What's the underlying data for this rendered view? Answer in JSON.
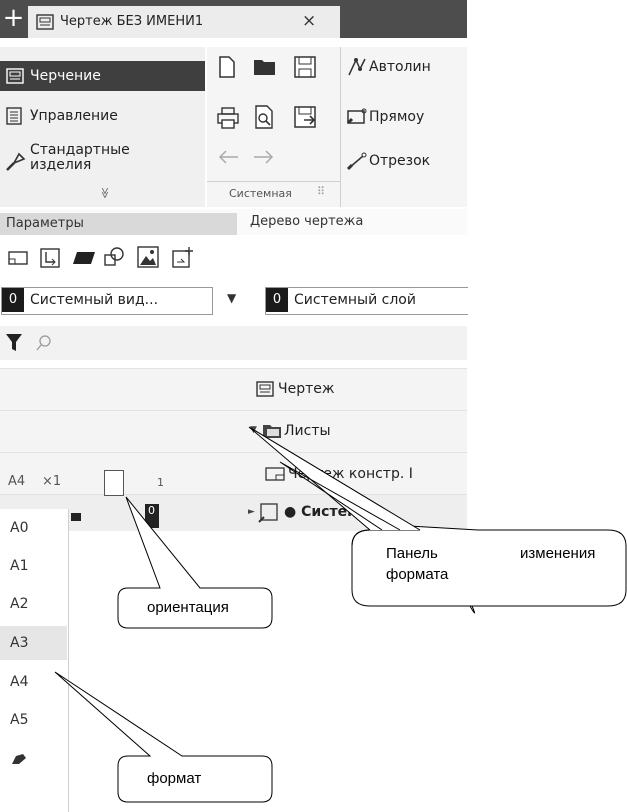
{
  "tab": {
    "title": "Чертеж БЕЗ ИМЕНИ1",
    "close": "×",
    "new": "+"
  },
  "left_panel": {
    "items": [
      {
        "label": "Черчение",
        "icon": "drawing-icon",
        "active": true
      },
      {
        "label": "Управление",
        "icon": "document-icon"
      },
      {
        "label": "Стандартные изделия",
        "label_line1": "Стандартные",
        "label_line2": "изделия",
        "icon": "key-icon"
      }
    ],
    "expand": "≫"
  },
  "toolbar": {
    "group_label": "Системная",
    "grip": "⠿",
    "tools": [
      {
        "label": "Автолин",
        "icon": "autoline-icon"
      },
      {
        "label": "Прямоу",
        "icon": "rectangle-icon"
      },
      {
        "label": "Отрезок",
        "icon": "segment-icon"
      }
    ]
  },
  "panel_tabs": {
    "params": "Параметры",
    "tree": "Дерево чертежа"
  },
  "selectors": {
    "view": {
      "number": "0",
      "value": "Системный вид..."
    },
    "layer": {
      "number": "0",
      "value": "Системный слой"
    }
  },
  "tree": {
    "root": "Чертеж",
    "sheets": "Листы",
    "sheet_item": "Чертеж констр. I",
    "system": "● Систем"
  },
  "sheet_row": {
    "format": "A4",
    "multiplier": "×1",
    "count": "1"
  },
  "sys_row": {
    "number": "0"
  },
  "format_list": [
    "A0",
    "A1",
    "A2",
    "A3",
    "A4",
    "A5"
  ],
  "format_selected": "A3",
  "callouts": {
    "panel_line1a": "Панель",
    "panel_line1b": "изменения",
    "panel_line2": "формата",
    "orientation": "ориентация",
    "format": "формат"
  },
  "colors": {
    "tabbar": "#4d4d4d",
    "active_item": "#3f3f3f",
    "num_badge": "#1b1b1b"
  }
}
